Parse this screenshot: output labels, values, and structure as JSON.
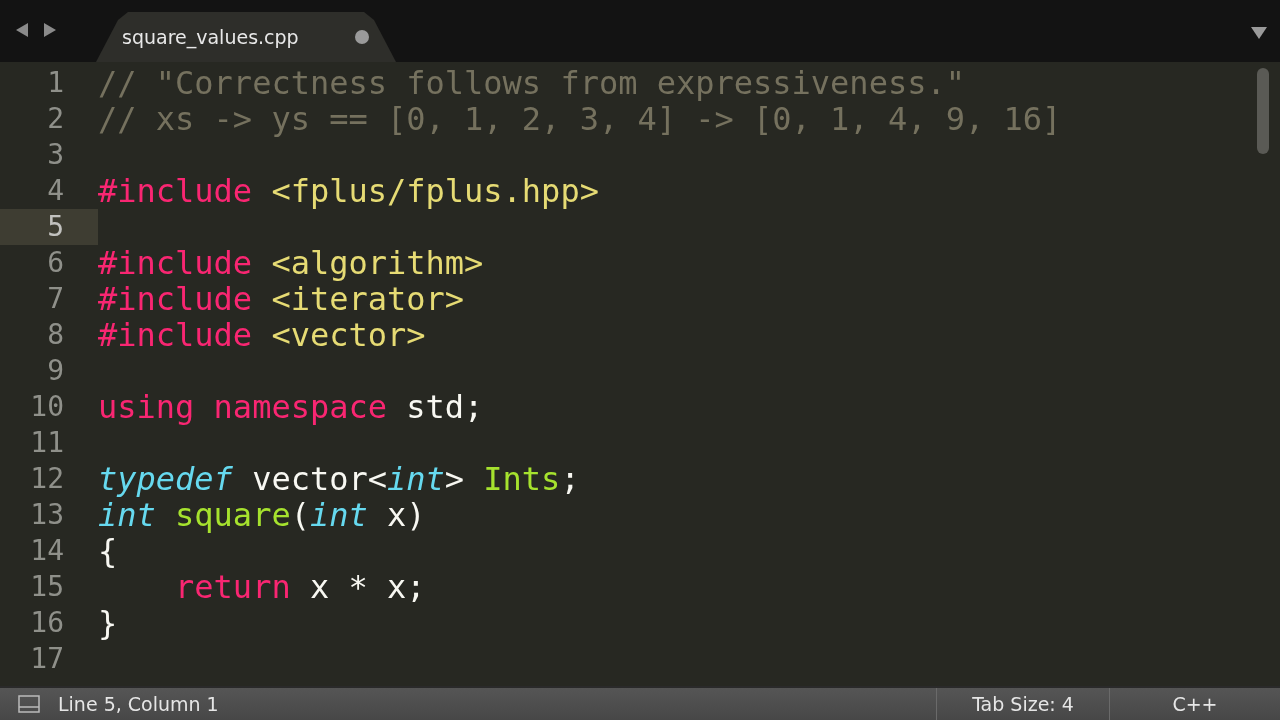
{
  "tabs": [
    {
      "label": "square_values.cpp",
      "selected": true,
      "modified": true
    }
  ],
  "lines": [
    {
      "number": "1",
      "current": false,
      "tokens": [
        {
          "kind": "comment",
          "text": "// \"Correctness follows from expressiveness.\""
        }
      ]
    },
    {
      "number": "2",
      "current": false,
      "tokens": [
        {
          "kind": "comment",
          "text": "// xs -> ys == [0, 1, 2, 3, 4] -> [0, 1, 4, 9, 16]"
        }
      ]
    },
    {
      "number": "3",
      "current": false
    },
    {
      "number": "4",
      "current": false,
      "tokens": [
        {
          "kind": "keyword",
          "text": "#include"
        },
        {
          "kind": "string",
          "text": " <fplus/fplus.hpp>"
        }
      ]
    },
    {
      "number": "5",
      "current": true
    },
    {
      "number": "6",
      "current": false,
      "tokens": [
        {
          "kind": "keyword",
          "text": "#include"
        },
        {
          "kind": "string",
          "text": " <algorithm>"
        }
      ]
    },
    {
      "number": "7",
      "current": false,
      "tokens": [
        {
          "kind": "keyword",
          "text": "#include"
        },
        {
          "kind": "string",
          "text": " <iterator>"
        }
      ]
    },
    {
      "number": "8",
      "current": false,
      "tokens": [
        {
          "kind": "keyword",
          "text": "#include"
        },
        {
          "kind": "string",
          "text": " <vector>"
        }
      ]
    },
    {
      "number": "9",
      "current": false
    },
    {
      "number": "10",
      "current": false,
      "tokens": [
        {
          "kind": "keyword",
          "text": "using namespace"
        },
        {
          "kind": "plain",
          "text": " std;"
        }
      ]
    },
    {
      "number": "11",
      "current": false
    },
    {
      "number": "12",
      "current": false,
      "tokens": [
        {
          "kind": "type",
          "text": "typedef"
        },
        {
          "kind": "plain",
          "text": " vector<"
        },
        {
          "kind": "type",
          "text": "int"
        },
        {
          "kind": "plain",
          "text": ">"
        },
        {
          "kind": "name",
          "text": " Ints"
        },
        {
          "kind": "plain",
          "text": ";"
        }
      ]
    },
    {
      "number": "13",
      "current": false,
      "tokens": [
        {
          "kind": "type",
          "text": "int"
        },
        {
          "kind": "name",
          "text": " square"
        },
        {
          "kind": "plain",
          "text": "("
        },
        {
          "kind": "type",
          "text": "int"
        },
        {
          "kind": "plain",
          "text": " x)"
        }
      ]
    },
    {
      "number": "14",
      "current": false,
      "tokens": [
        {
          "kind": "plain",
          "text": "{"
        }
      ]
    },
    {
      "number": "15",
      "current": false,
      "tokens": [
        {
          "kind": "keyword",
          "text": "    return"
        },
        {
          "kind": "plain",
          "text": " x * x;"
        }
      ]
    },
    {
      "number": "16",
      "current": false,
      "tokens": [
        {
          "kind": "plain",
          "text": "}"
        }
      ]
    },
    {
      "number": "17",
      "current": false
    }
  ],
  "status_bar": {
    "position": "Line 5, Column 1",
    "tab_size": "Tab Size: 4",
    "syntax": "C++"
  }
}
